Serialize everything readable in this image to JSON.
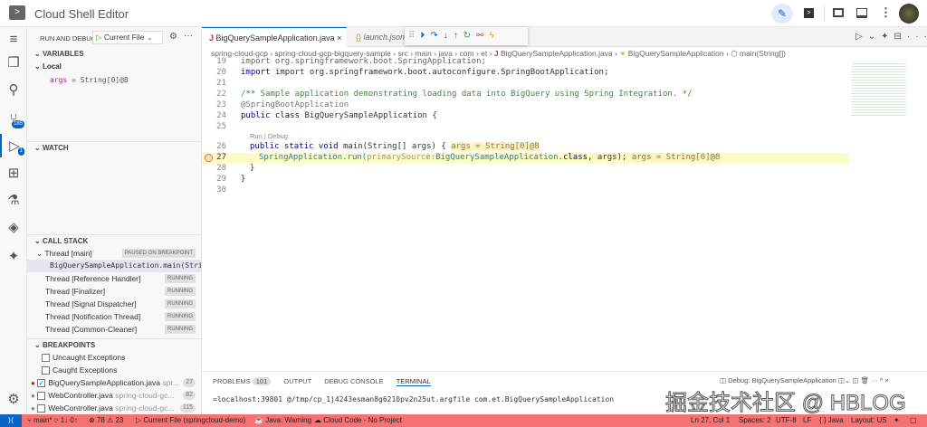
{
  "title": "Cloud Shell Editor",
  "titlebar_icons": [
    "edit-icon",
    "terminal-icon",
    "preview-icon",
    "panel-icon",
    "more-icon",
    "avatar"
  ],
  "run_debug": {
    "header": "RUN AND DEBUG",
    "config": "Current File"
  },
  "activity": {
    "scm_badge": "185",
    "debug_badge": "1"
  },
  "variables": {
    "header": "VARIABLES",
    "scope": "Local",
    "var_name": "args",
    "var_value": "= String[0]@8"
  },
  "watch": {
    "header": "WATCH"
  },
  "call_stack": {
    "header": "CALL STACK",
    "threads": [
      {
        "name": "Thread [main]",
        "status": "PAUSED ON BREAKPOINT"
      },
      {
        "name": "BigQuerySampleApplication.main(String[])",
        "status": ""
      },
      {
        "name": "Thread [Reference Handler]",
        "status": "RUNNING"
      },
      {
        "name": "Thread [Finalizer]",
        "status": "RUNNING"
      },
      {
        "name": "Thread [Signal Dispatcher]",
        "status": "RUNNING"
      },
      {
        "name": "Thread [Notification Thread]",
        "status": "RUNNING"
      },
      {
        "name": "Thread [Common-Cleaner]",
        "status": "RUNNING"
      }
    ]
  },
  "breakpoints": {
    "header": "BREAKPOINTS",
    "items": [
      {
        "label": "Uncaught Exceptions",
        "path": "",
        "line": ""
      },
      {
        "label": "Caught Exceptions",
        "path": "",
        "line": ""
      },
      {
        "label": "BigQuerySampleApplication.java",
        "path": "spr...",
        "line": "27",
        "checked": true
      },
      {
        "label": "WebController.java",
        "path": "spring-cloud-gc...",
        "line": "82"
      },
      {
        "label": "WebController.java",
        "path": "spring-cloud-gc...",
        "line": "115"
      }
    ]
  },
  "tabs": [
    {
      "label": "BigQuerySampleApplication.java",
      "close": "×"
    },
    {
      "label": "launch.json"
    }
  ],
  "breadcrumbs": [
    "spring-cloud-gcp",
    "spring-cloud-gcp-bigquery-sample",
    "src",
    "main",
    "java",
    "com",
    "et",
    "BigQuerySampleApplication.java",
    "BigQuerySampleApplication",
    "main(String[])"
  ],
  "code": {
    "l19": "import org.springframework.boot.SpringApplication;",
    "l20": "import org.springframework.boot.autoconfigure.SpringBootApplication;",
    "l22": "/** Sample application demonstrating loading data into BigQuery using Spring Integration. */",
    "l23": "@SpringBootApplication",
    "l24a": "public class",
    "l24b": " BigQuerySampleApplication {",
    "codelens": "Run | Debug",
    "l26a": "public static void",
    "l26b": " main(String[] args) {",
    "l26i": "args = String[0]@8",
    "l27a": "SpringApplication.run(",
    "l27h": "primarySource:",
    "l27b": "BigQuerySampleApplication.",
    "l27c": "class",
    "l27d": ", args);",
    "l27i": "args = String[0]@8",
    "l28": "}",
    "l29": "}",
    "line_numbers": [
      "19",
      "20",
      "21",
      "22",
      "23",
      "24",
      "25",
      "26",
      "27",
      "28",
      "29",
      "30"
    ]
  },
  "panel": {
    "tabs": [
      "PROBLEMS",
      "OUTPUT",
      "DEBUG CONSOLE",
      "TERMINAL"
    ],
    "problems_count": "101",
    "terminal_name": "Debug: BigQuerySampleApplication",
    "terminal_line": "=localhost:39801 @/tmp/cp_1j4243esman8g6210pv2n25ut.argfile com.et.BigQuerySampleApplication"
  },
  "watermark": "掘金技术社区 @ HBLOG",
  "status": {
    "branch": "main*",
    "sync": "1↓ 0↑",
    "errors": "78",
    "warnings": "23",
    "launch": "Current File (springcloud-demo)",
    "java": "Java: Warning",
    "cloud": "Cloud Code - No Project",
    "position": "Ln 27, Col 1",
    "spaces": "Spaces: 2",
    "encoding": "UTF-8",
    "eol": "LF",
    "lang": "{ } Java",
    "layout": "Layout: US"
  },
  "colors": {
    "status_bg": "#f47272",
    "accent": "#0b63c4"
  }
}
